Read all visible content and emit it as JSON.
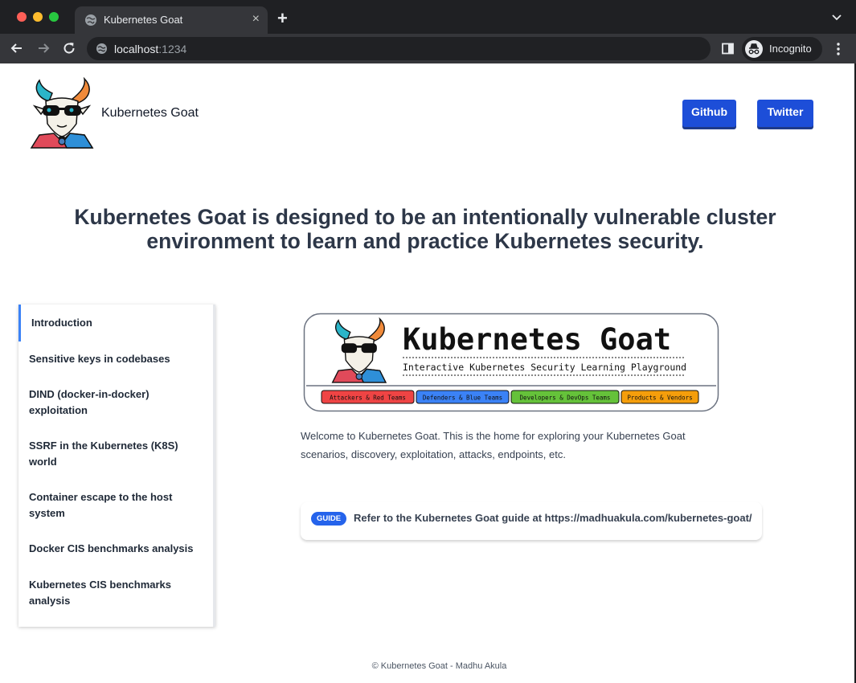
{
  "browser": {
    "tab_title": "Kubernetes Goat",
    "tab_close": "×",
    "new_tab": "+",
    "url_host": "localhost",
    "url_port": ":1234",
    "profile_label": "Incognito"
  },
  "header": {
    "site_name": "Kubernetes Goat",
    "github_label": "Github",
    "twitter_label": "Twitter"
  },
  "hero": {
    "headline": "Kubernetes Goat is designed to be an intentionally vulnerable cluster environment to learn and practice Kubernetes security."
  },
  "sidebar": {
    "items": [
      {
        "label": "Introduction",
        "active": true
      },
      {
        "label": "Sensitive keys in codebases",
        "active": false
      },
      {
        "label": "DIND (docker-in-docker) exploitation",
        "active": false
      },
      {
        "label": "SSRF in the Kubernetes (K8S) world",
        "active": false
      },
      {
        "label": "Container escape to the host system",
        "active": false
      },
      {
        "label": "Docker CIS benchmarks analysis",
        "active": false
      },
      {
        "label": "Kubernetes CIS benchmarks analysis",
        "active": false
      }
    ]
  },
  "banner": {
    "title": "Kubernetes Goat",
    "subtitle": "Interactive Kubernetes Security Learning Playground",
    "tags": [
      {
        "label": "Attackers & Red Teams",
        "color": "#ef4444"
      },
      {
        "label": "Defenders & Blue Teams",
        "color": "#3b82f6"
      },
      {
        "label": "Developers & DevOps Teams",
        "color": "#65c23a"
      },
      {
        "label": "Products & Vendors",
        "color": "#f59e0b"
      }
    ]
  },
  "main": {
    "welcome": "Welcome to Kubernetes Goat. This is the home for exploring your Kubernetes Goat scenarios, discovery, exploitation, attacks, endpoints, etc.",
    "guide_badge": "GUIDE",
    "guide_text": "Refer to the Kubernetes Goat guide at https://madhuakula.com/kubernetes-goat/"
  },
  "footer": {
    "text": "© Kubernetes Goat - Madhu Akula"
  }
}
